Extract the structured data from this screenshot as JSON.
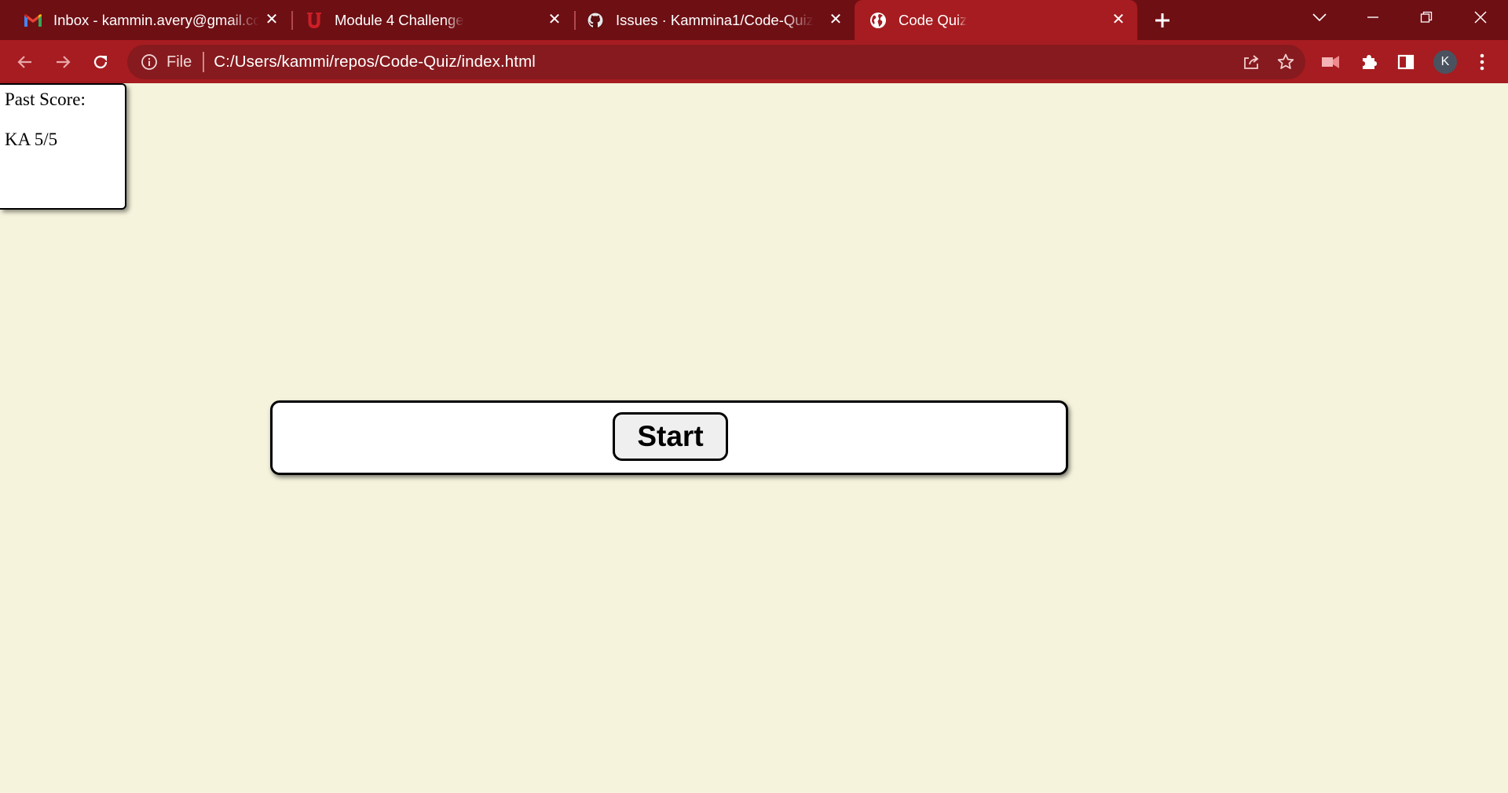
{
  "browser": {
    "tabs": [
      {
        "title": "Inbox - kammin.avery@gmail.com",
        "icon": "gmail-icon",
        "active": false
      },
      {
        "title": "Module 4 Challenge",
        "icon": "university-utah-icon",
        "active": false
      },
      {
        "title": "Issues · Kammina1/Code-Quiz",
        "icon": "github-icon",
        "active": false
      },
      {
        "title": "Code Quiz",
        "icon": "globe-icon",
        "active": true
      }
    ],
    "address_bar": {
      "scheme_label": "File",
      "url": "C:/Users/kammi/repos/Code-Quiz/index.html"
    },
    "profile_initial": "K",
    "colors": {
      "tabstrip": "#6e0f14",
      "toolbar": "#a61c20",
      "omnibox": "#861a1e"
    }
  },
  "page": {
    "background": "#f5f3dc",
    "past_score": {
      "title": "Past Score:",
      "entry": "KA 5/5"
    },
    "start_label": "Start"
  }
}
